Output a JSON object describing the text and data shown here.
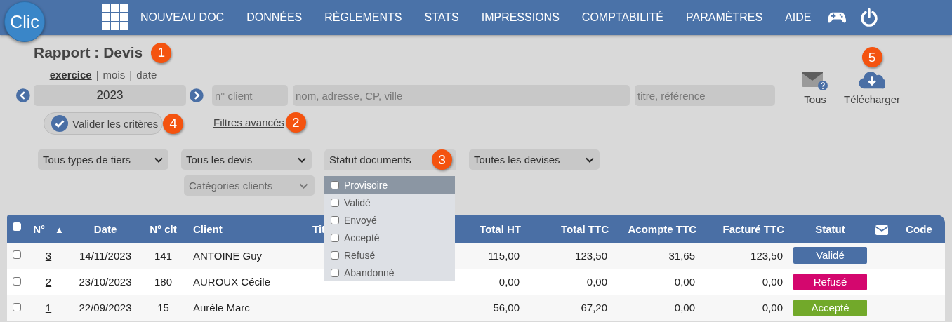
{
  "nav": {
    "logo": "Clic",
    "items": [
      "NOUVEAU DOC",
      "DONNÉES",
      "RÈGLEMENTS",
      "STATS",
      "IMPRESSIONS",
      "COMPTABILITÉ",
      "PARAMÈTRES",
      "AIDE"
    ]
  },
  "page_title": {
    "text": "Rapport : Devis",
    "callout": "1"
  },
  "period_modes": [
    {
      "label": "exercice",
      "selected": true
    },
    {
      "label": "mois",
      "selected": false
    },
    {
      "label": "date",
      "selected": false
    }
  ],
  "period_separators": [
    "|",
    "|"
  ],
  "year": "2023",
  "search_fields": [
    {
      "placeholder": "n° client"
    },
    {
      "placeholder": "nom, adresse, CP, ville"
    },
    {
      "placeholder": "titre, référence"
    }
  ],
  "actions": [
    {
      "kind": "mail",
      "label": "Tous"
    },
    {
      "kind": "download",
      "label": "Télécharger",
      "callout": "5"
    }
  ],
  "validate": {
    "label": "Valider les critères",
    "callout": "4"
  },
  "advanced_filters": {
    "label": "Filtres avancés",
    "callout": "2"
  },
  "filters": [
    {
      "kind": "select",
      "label": "Tous types de tiers"
    },
    {
      "kind": "select",
      "label": "Tous les devis"
    },
    {
      "kind": "multiselect",
      "label": "Statut documents",
      "callout": "3",
      "expanded": true,
      "options": [
        {
          "label": "Provisoire",
          "checked": false,
          "selected": true
        },
        {
          "label": "Validé",
          "checked": false,
          "selected": false
        },
        {
          "label": "Envoyé",
          "checked": false,
          "selected": false
        },
        {
          "label": "Accepté",
          "checked": false,
          "selected": false
        },
        {
          "label": "Refusé",
          "checked": false,
          "selected": false
        },
        {
          "label": "Abandonné",
          "checked": false,
          "selected": false
        }
      ]
    },
    {
      "kind": "select",
      "label": "Toutes les devises"
    }
  ],
  "filters_row_2": [
    {
      "kind": "select",
      "label": "Catégories clients",
      "disabled": true
    }
  ],
  "table": {
    "all_checked": false,
    "columns": [
      {
        "kind": "link",
        "label": "N°",
        "sort": "▲"
      },
      {
        "kind": "text",
        "label": "Date"
      },
      {
        "kind": "text",
        "label": "N° clt"
      },
      {
        "kind": "text",
        "label": "Client"
      },
      {
        "kind": "text",
        "label": "Tit"
      },
      {
        "kind": "text",
        "label": "Total HT"
      },
      {
        "kind": "text",
        "label": "Total TTC"
      },
      {
        "kind": "text",
        "label": "Acompte TTC"
      },
      {
        "kind": "text",
        "label": "Facturé TTC"
      },
      {
        "kind": "text",
        "label": "Statut"
      },
      {
        "kind": "mail"
      },
      {
        "kind": "text",
        "label": "Code"
      }
    ],
    "rows": [
      {
        "checked": false,
        "number": "3",
        "date": "14/11/2023",
        "client_no": "141",
        "client": "ANTOINE Guy",
        "total_ht": "115,00",
        "total_ttc": "123,50",
        "deposit_ttc": "31,65",
        "invoiced_ttc": "123,50",
        "status": {
          "label": "Validé",
          "color": "#4a6fa5"
        }
      },
      {
        "checked": false,
        "number": "2",
        "date": "23/10/2023",
        "client_no": "180",
        "client": "AUROUX Cécile",
        "total_ht": "0,00",
        "total_ttc": "0,00",
        "deposit_ttc": "0,00",
        "invoiced_ttc": "0,00",
        "status": {
          "label": "Refusé",
          "color": "#d4076e"
        }
      },
      {
        "checked": false,
        "number": "1",
        "date": "22/09/2023",
        "client_no": "15",
        "client": "Aurèle Marc",
        "total_ht": "56,00",
        "total_ttc": "67,20",
        "deposit_ttc": "0,00",
        "invoiced_ttc": "0,00",
        "status": {
          "label": "Accepté",
          "color": "#72a92a"
        }
      }
    ]
  }
}
